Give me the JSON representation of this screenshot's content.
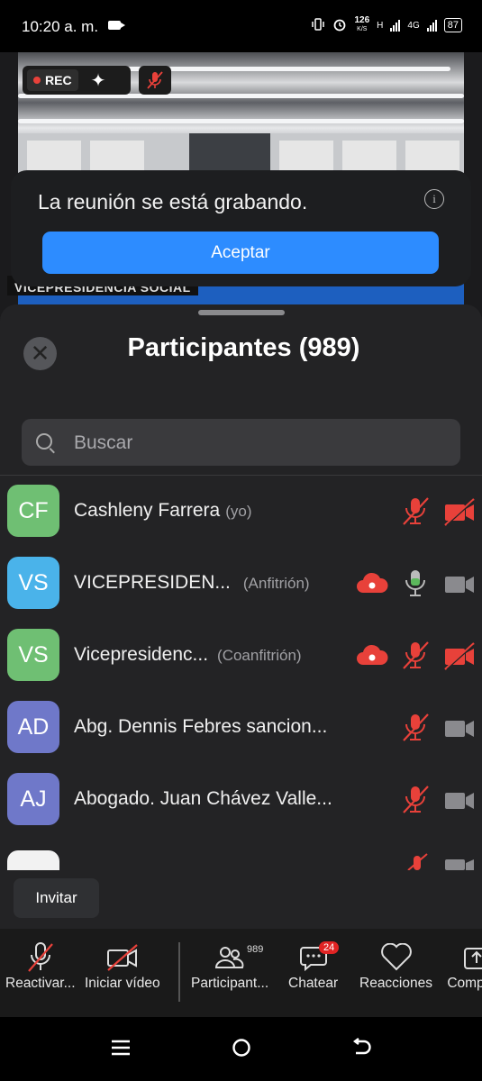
{
  "status_bar": {
    "time": "10:20 a. m.",
    "network_speed_value": "126",
    "network_speed_unit": "K/S",
    "network_h": "H",
    "network_4g": "4G",
    "battery": "87"
  },
  "video": {
    "rec_label": "REC",
    "caption": "VICEPRESIDENCIA SOCIAL"
  },
  "toast": {
    "message": "La reunión se está grabando.",
    "accept_label": "Aceptar",
    "info_glyph": "i"
  },
  "participants_sheet": {
    "title": "Participantes (989)",
    "search_placeholder": "Buscar",
    "participants": [
      {
        "initials": "CF",
        "name": "Cashleny Farrera",
        "role": "(yo)",
        "color": "#6fbf73",
        "cloud_recording": false,
        "mic": "muted",
        "video": "off"
      },
      {
        "initials": "VS",
        "name": "VICEPRESIDEN...",
        "role": "(Anfitrión)",
        "color": "#4ab3ea",
        "cloud_recording": true,
        "mic": "on",
        "video": "available"
      },
      {
        "initials": "VS",
        "name": "Vicepresidenc...",
        "role": "(Coanfitrión)",
        "color": "#6fbf73",
        "cloud_recording": true,
        "mic": "muted",
        "video": "off"
      },
      {
        "initials": "AD",
        "name": "Abg. Dennis Febres sancion...",
        "role": "",
        "color": "#6f78c9",
        "cloud_recording": false,
        "mic": "muted",
        "video": "available"
      },
      {
        "initials": "AJ",
        "name": "Abogado. Juan Chávez Valle...",
        "role": "",
        "color": "#6f78c9",
        "cloud_recording": false,
        "mic": "muted",
        "video": "available"
      }
    ],
    "invite_label": "Invitar"
  },
  "toolbar": {
    "unmute_label": "Reactivar...",
    "start_video_label": "Iniciar vídeo",
    "participants_label": "Participant...",
    "participants_count": "989",
    "chat_label": "Chatear",
    "chat_badge": "24",
    "reactions_label": "Reacciones",
    "share_label": "Comp"
  },
  "colors": {
    "accent_blue": "#2d8cff",
    "muted_red": "#e8413a",
    "mic_green": "#5cb85c"
  }
}
